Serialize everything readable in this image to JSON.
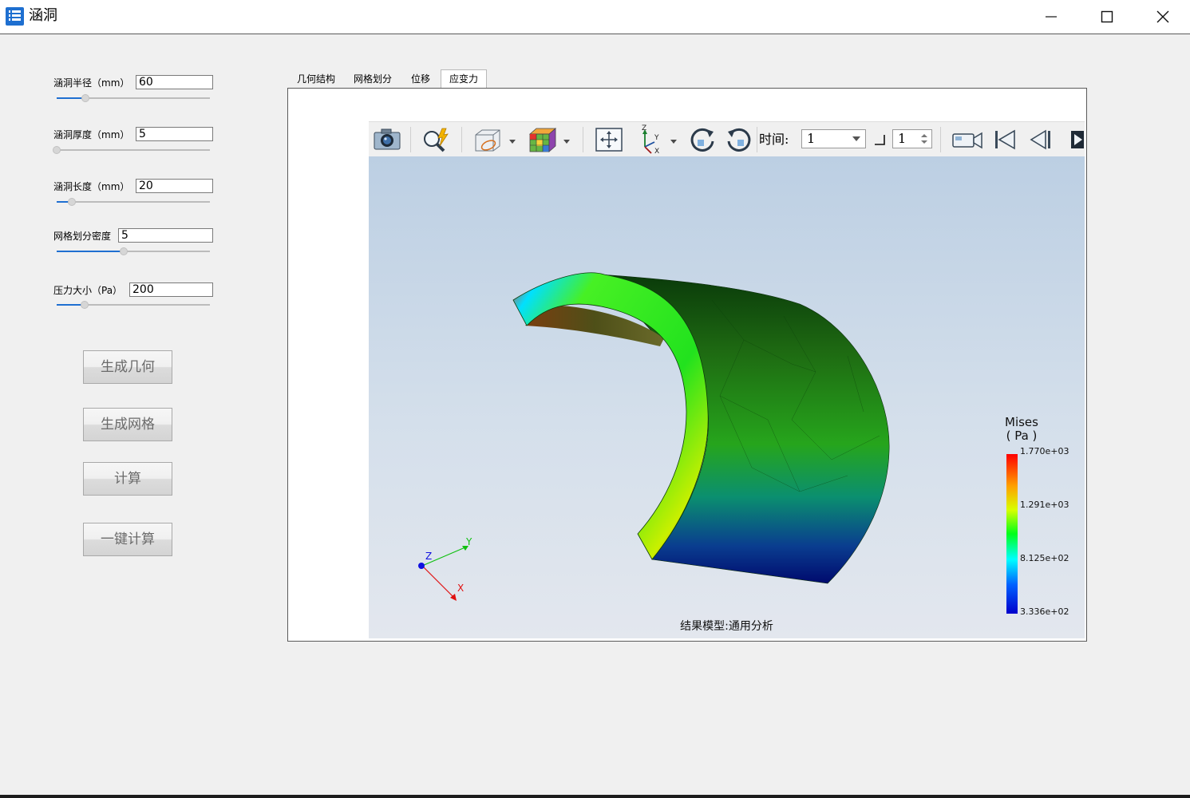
{
  "window": {
    "title": "涵洞"
  },
  "params": [
    {
      "label": "涵洞半径（mm）",
      "value": "60",
      "level_percent": 19
    },
    {
      "label": "涵洞厚度（mm）",
      "value": "5",
      "level_percent": 0
    },
    {
      "label": "涵洞长度（mm）",
      "value": "20",
      "level_percent": 10
    },
    {
      "label": "网格划分密度",
      "value": "5",
      "level_percent": 44
    },
    {
      "label": "压力大小（Pa）",
      "value": "200",
      "level_percent": 18
    }
  ],
  "buttons": {
    "generate_geometry": "生成几何",
    "generate_mesh": "生成网格",
    "compute": "计算",
    "one_click_compute": "一键计算"
  },
  "tabs": [
    "几何结构",
    "网格划分",
    "位移",
    "应变力"
  ],
  "active_tab": "应变力",
  "toolbar": {
    "icons": [
      "camera-icon",
      "zoom-lightning-icon",
      "view-cube-icon",
      "mesh-color-cube-icon",
      "fit-all-icon",
      "axes-icon",
      "rotate-cw-icon",
      "rotate-ccw-icon",
      "video-camera-icon",
      "first-frame-icon",
      "previous-frame-icon",
      "next-frame-icon"
    ],
    "time_label": "时间:",
    "time_value": "1",
    "step_value": "1"
  },
  "viewport": {
    "caption": "结果模型:通用分析",
    "legend": {
      "title_line1": "Mises",
      "title_line2": "( Pa )",
      "ticks": [
        "1.770e+03",
        "1.291e+03",
        "8.125e+02",
        "3.336e+02"
      ]
    },
    "axes": {
      "x": "X",
      "y": "Y",
      "z": "Z"
    }
  },
  "colors": {
    "slider_fill": "#1f6fd1",
    "legend_max": "#ff0000",
    "legend_min": "#0000cc"
  }
}
